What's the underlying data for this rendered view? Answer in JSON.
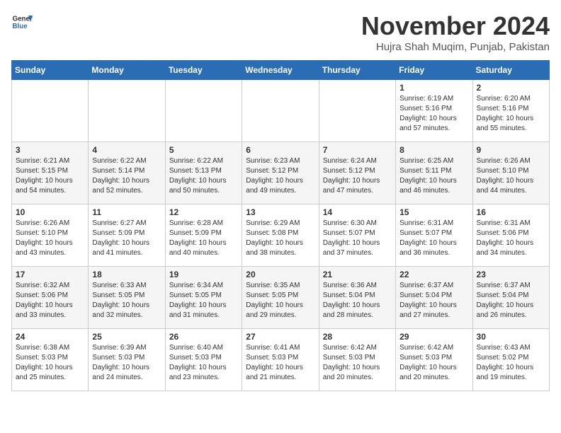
{
  "logo": {
    "line1": "General",
    "line2": "Blue"
  },
  "title": "November 2024",
  "subtitle": "Hujra Shah Muqim, Punjab, Pakistan",
  "days_of_week": [
    "Sunday",
    "Monday",
    "Tuesday",
    "Wednesday",
    "Thursday",
    "Friday",
    "Saturday"
  ],
  "weeks": [
    [
      {
        "day": "",
        "info": ""
      },
      {
        "day": "",
        "info": ""
      },
      {
        "day": "",
        "info": ""
      },
      {
        "day": "",
        "info": ""
      },
      {
        "day": "",
        "info": ""
      },
      {
        "day": "1",
        "info": "Sunrise: 6:19 AM\nSunset: 5:16 PM\nDaylight: 10 hours\nand 57 minutes."
      },
      {
        "day": "2",
        "info": "Sunrise: 6:20 AM\nSunset: 5:16 PM\nDaylight: 10 hours\nand 55 minutes."
      }
    ],
    [
      {
        "day": "3",
        "info": "Sunrise: 6:21 AM\nSunset: 5:15 PM\nDaylight: 10 hours\nand 54 minutes."
      },
      {
        "day": "4",
        "info": "Sunrise: 6:22 AM\nSunset: 5:14 PM\nDaylight: 10 hours\nand 52 minutes."
      },
      {
        "day": "5",
        "info": "Sunrise: 6:22 AM\nSunset: 5:13 PM\nDaylight: 10 hours\nand 50 minutes."
      },
      {
        "day": "6",
        "info": "Sunrise: 6:23 AM\nSunset: 5:12 PM\nDaylight: 10 hours\nand 49 minutes."
      },
      {
        "day": "7",
        "info": "Sunrise: 6:24 AM\nSunset: 5:12 PM\nDaylight: 10 hours\nand 47 minutes."
      },
      {
        "day": "8",
        "info": "Sunrise: 6:25 AM\nSunset: 5:11 PM\nDaylight: 10 hours\nand 46 minutes."
      },
      {
        "day": "9",
        "info": "Sunrise: 6:26 AM\nSunset: 5:10 PM\nDaylight: 10 hours\nand 44 minutes."
      }
    ],
    [
      {
        "day": "10",
        "info": "Sunrise: 6:26 AM\nSunset: 5:10 PM\nDaylight: 10 hours\nand 43 minutes."
      },
      {
        "day": "11",
        "info": "Sunrise: 6:27 AM\nSunset: 5:09 PM\nDaylight: 10 hours\nand 41 minutes."
      },
      {
        "day": "12",
        "info": "Sunrise: 6:28 AM\nSunset: 5:09 PM\nDaylight: 10 hours\nand 40 minutes."
      },
      {
        "day": "13",
        "info": "Sunrise: 6:29 AM\nSunset: 5:08 PM\nDaylight: 10 hours\nand 38 minutes."
      },
      {
        "day": "14",
        "info": "Sunrise: 6:30 AM\nSunset: 5:07 PM\nDaylight: 10 hours\nand 37 minutes."
      },
      {
        "day": "15",
        "info": "Sunrise: 6:31 AM\nSunset: 5:07 PM\nDaylight: 10 hours\nand 36 minutes."
      },
      {
        "day": "16",
        "info": "Sunrise: 6:31 AM\nSunset: 5:06 PM\nDaylight: 10 hours\nand 34 minutes."
      }
    ],
    [
      {
        "day": "17",
        "info": "Sunrise: 6:32 AM\nSunset: 5:06 PM\nDaylight: 10 hours\nand 33 minutes."
      },
      {
        "day": "18",
        "info": "Sunrise: 6:33 AM\nSunset: 5:05 PM\nDaylight: 10 hours\nand 32 minutes."
      },
      {
        "day": "19",
        "info": "Sunrise: 6:34 AM\nSunset: 5:05 PM\nDaylight: 10 hours\nand 31 minutes."
      },
      {
        "day": "20",
        "info": "Sunrise: 6:35 AM\nSunset: 5:05 PM\nDaylight: 10 hours\nand 29 minutes."
      },
      {
        "day": "21",
        "info": "Sunrise: 6:36 AM\nSunset: 5:04 PM\nDaylight: 10 hours\nand 28 minutes."
      },
      {
        "day": "22",
        "info": "Sunrise: 6:37 AM\nSunset: 5:04 PM\nDaylight: 10 hours\nand 27 minutes."
      },
      {
        "day": "23",
        "info": "Sunrise: 6:37 AM\nSunset: 5:04 PM\nDaylight: 10 hours\nand 26 minutes."
      }
    ],
    [
      {
        "day": "24",
        "info": "Sunrise: 6:38 AM\nSunset: 5:03 PM\nDaylight: 10 hours\nand 25 minutes."
      },
      {
        "day": "25",
        "info": "Sunrise: 6:39 AM\nSunset: 5:03 PM\nDaylight: 10 hours\nand 24 minutes."
      },
      {
        "day": "26",
        "info": "Sunrise: 6:40 AM\nSunset: 5:03 PM\nDaylight: 10 hours\nand 23 minutes."
      },
      {
        "day": "27",
        "info": "Sunrise: 6:41 AM\nSunset: 5:03 PM\nDaylight: 10 hours\nand 21 minutes."
      },
      {
        "day": "28",
        "info": "Sunrise: 6:42 AM\nSunset: 5:03 PM\nDaylight: 10 hours\nand 20 minutes."
      },
      {
        "day": "29",
        "info": "Sunrise: 6:42 AM\nSunset: 5:03 PM\nDaylight: 10 hours\nand 20 minutes."
      },
      {
        "day": "30",
        "info": "Sunrise: 6:43 AM\nSunset: 5:02 PM\nDaylight: 10 hours\nand 19 minutes."
      }
    ]
  ]
}
